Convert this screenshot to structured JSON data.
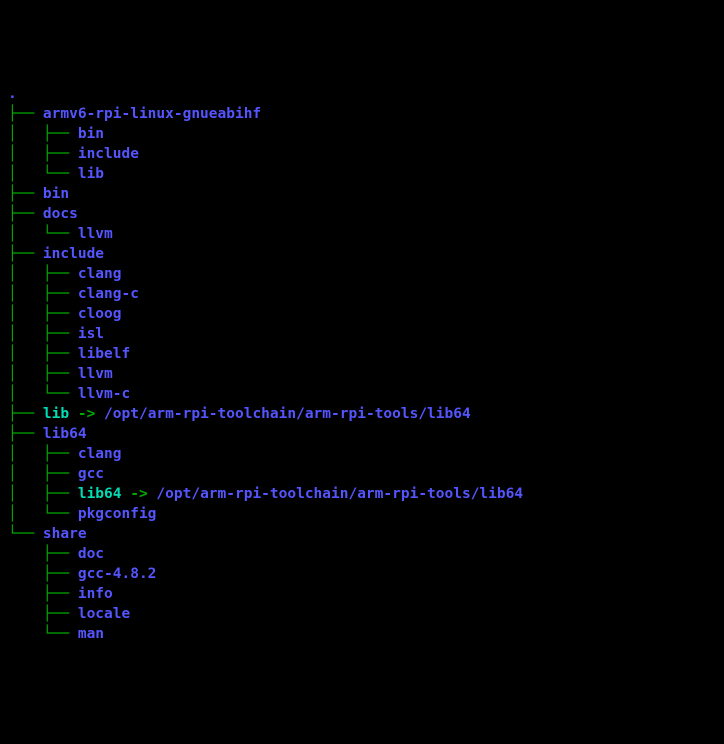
{
  "root": ".",
  "symlink_target": "/opt/arm-rpi-toolchain/arm-rpi-tools/lib64",
  "arrow": " -> ",
  "tree": {
    "armv6": "armv6-rpi-linux-gnueabihf",
    "armv6_bin": "bin",
    "armv6_include": "include",
    "armv6_lib": "lib",
    "bin": "bin",
    "docs": "docs",
    "docs_llvm": "llvm",
    "include": "include",
    "inc_clang": "clang",
    "inc_clang_c": "clang-c",
    "inc_cloog": "cloog",
    "inc_isl": "isl",
    "inc_libelf": "libelf",
    "inc_llvm": "llvm",
    "inc_llvm_c": "llvm-c",
    "lib_link": "lib",
    "lib64": "lib64",
    "lib64_clang": "clang",
    "lib64_gcc": "gcc",
    "lib64_lib64_link": "lib64",
    "lib64_pkgconfig": "pkgconfig",
    "share": "share",
    "share_doc": "doc",
    "share_gcc": "gcc-4.8.2",
    "share_info": "info",
    "share_locale": "locale",
    "share_man": "man"
  },
  "branches": {
    "tee": "├── ",
    "last": "└── ",
    "pipe": "│   ",
    "blank": "    "
  }
}
